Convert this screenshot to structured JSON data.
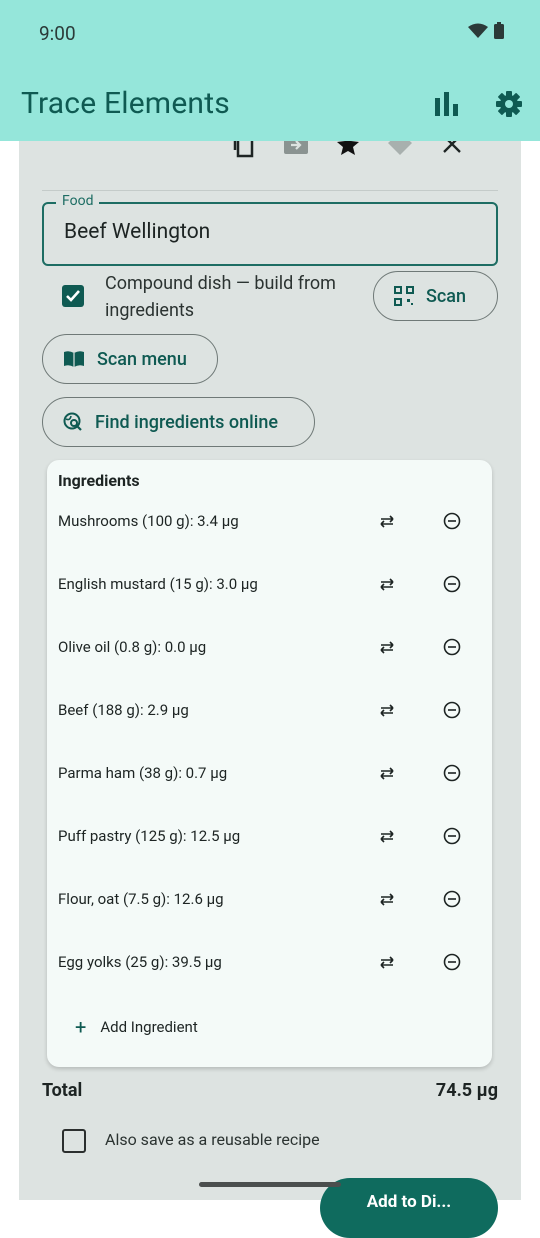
{
  "status_bar": {
    "time": "9:00"
  },
  "app_bar": {
    "title": "Trace Elements",
    "icons": [
      "bar-chart-icon",
      "settings-icon"
    ]
  },
  "toolbar": {
    "icons": [
      "copy-icon",
      "move-icon",
      "star-icon",
      "heart-icon",
      "close-icon"
    ]
  },
  "food_field": {
    "label": "Food",
    "value": "Beef Wellington"
  },
  "compound": {
    "label": "Compound dish — build from ingredients",
    "checked": true
  },
  "buttons": {
    "scan": "Scan",
    "scan_menu": "Scan menu",
    "find_online": "Find ingredients online"
  },
  "ingredients": {
    "title": "Ingredients",
    "items": [
      {
        "label": "Mushrooms (100 g): 3.4 µg"
      },
      {
        "label": "English mustard (15 g): 3.0 µg"
      },
      {
        "label": "Olive oil (0.8 g): 0.0 µg"
      },
      {
        "label": "Beef (188 g): 2.9 µg"
      },
      {
        "label": "Parma ham (38 g): 0.7 µg"
      },
      {
        "label": "Puff pastry (125 g): 12.5 µg"
      },
      {
        "label": "Flour, oat (7.5 g): 12.6 µg"
      },
      {
        "label": "Egg yolks (25 g): 39.5 µg"
      }
    ],
    "add_label": "Add Ingredient"
  },
  "total": {
    "label": "Total",
    "value": "74.5 µg"
  },
  "save_recipe": {
    "label": "Also save as a reusable recipe",
    "checked": false
  },
  "fab": {
    "label": "Add to Di..."
  },
  "colors": {
    "primary": "#0f5a52",
    "app_bar": "#95e6da",
    "sheet": "#dde3e1",
    "card": "#f4faf8"
  }
}
